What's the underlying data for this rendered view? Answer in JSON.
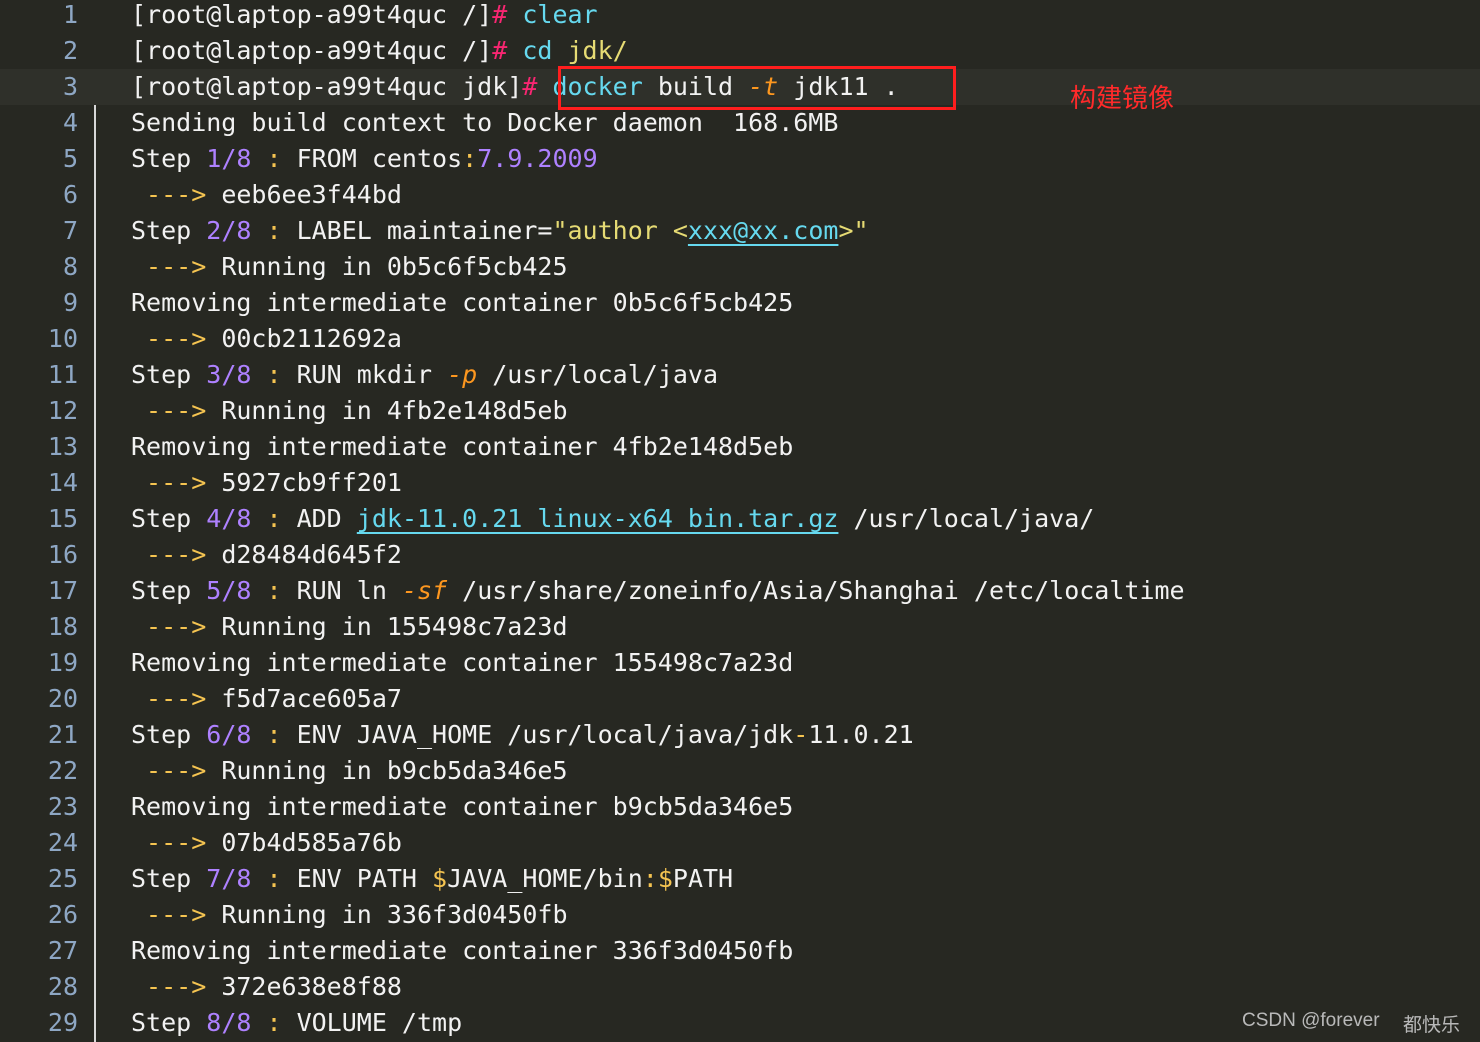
{
  "annotation": "构建镜像",
  "watermark": "CSDN @forever",
  "watermark_cn": "都快乐",
  "lines": [
    {
      "n": "1",
      "parts": [
        [
          "",
          "[root@laptop-a99t4quc /]"
        ],
        [
          "c-prompt",
          "# "
        ],
        [
          "c-cmd",
          "clear"
        ]
      ]
    },
    {
      "n": "2",
      "parts": [
        [
          "",
          "[root@laptop-a99t4quc /]"
        ],
        [
          "c-prompt",
          "# "
        ],
        [
          "c-cmd",
          "cd "
        ],
        [
          "c-str",
          "jdk/"
        ]
      ]
    },
    {
      "n": "3",
      "parts": [
        [
          "",
          "[root@laptop-a99t4quc jdk]"
        ],
        [
          "c-prompt",
          "# "
        ],
        [
          "c-cmd",
          "docker"
        ],
        [
          "",
          " build "
        ],
        [
          "c-flag",
          "-t"
        ],
        [
          "",
          " jdk11 ."
        ]
      ]
    },
    {
      "n": "4",
      "parts": [
        [
          "",
          "Sending build context to Docker daemon  168.6MB"
        ]
      ]
    },
    {
      "n": "5",
      "parts": [
        [
          "",
          "Step "
        ],
        [
          "c-num",
          "1/8"
        ],
        [
          "c-colon",
          " : "
        ],
        [
          "",
          "FROM centos"
        ],
        [
          "c-colon",
          ":"
        ],
        [
          "c-num",
          "7.9.2009"
        ]
      ]
    },
    {
      "n": "6",
      "parts": [
        [
          "c-colon",
          " ---> "
        ],
        [
          "",
          "eeb6ee3f44bd"
        ]
      ]
    },
    {
      "n": "7",
      "parts": [
        [
          "",
          "Step "
        ],
        [
          "c-num",
          "2/8"
        ],
        [
          "c-colon",
          " : "
        ],
        [
          "",
          "LABEL maintainer="
        ],
        [
          "c-str",
          "\"author <"
        ],
        [
          "c-link",
          "xxx@xx.com"
        ],
        [
          "c-str",
          ">\""
        ]
      ]
    },
    {
      "n": "8",
      "parts": [
        [
          "c-colon",
          " ---> "
        ],
        [
          "",
          "Running in 0b5c6f5cb425"
        ]
      ]
    },
    {
      "n": "9",
      "parts": [
        [
          "",
          "Removing intermediate container 0b5c6f5cb425"
        ]
      ]
    },
    {
      "n": "10",
      "parts": [
        [
          "c-colon",
          " ---> "
        ],
        [
          "",
          "00cb2112692a"
        ]
      ]
    },
    {
      "n": "11",
      "parts": [
        [
          "",
          "Step "
        ],
        [
          "c-num",
          "3/8"
        ],
        [
          "c-colon",
          " : "
        ],
        [
          "",
          "RUN mkdir "
        ],
        [
          "c-flag",
          "-p"
        ],
        [
          "",
          " /usr/local/java"
        ]
      ]
    },
    {
      "n": "12",
      "parts": [
        [
          "c-colon",
          " ---> "
        ],
        [
          "",
          "Running in 4fb2e148d5eb"
        ]
      ]
    },
    {
      "n": "13",
      "parts": [
        [
          "",
          "Removing intermediate container 4fb2e148d5eb"
        ]
      ]
    },
    {
      "n": "14",
      "parts": [
        [
          "c-colon",
          " ---> "
        ],
        [
          "",
          "5927cb9ff201"
        ]
      ]
    },
    {
      "n": "15",
      "parts": [
        [
          "",
          "Step "
        ],
        [
          "c-num",
          "4/8"
        ],
        [
          "c-colon",
          " : "
        ],
        [
          "",
          "ADD "
        ],
        [
          "c-link",
          "jdk-11.0.21_linux-x64_bin.tar.gz"
        ],
        [
          "",
          " /usr/local/java/"
        ]
      ]
    },
    {
      "n": "16",
      "parts": [
        [
          "c-colon",
          " ---> "
        ],
        [
          "",
          "d28484d645f2"
        ]
      ]
    },
    {
      "n": "17",
      "parts": [
        [
          "",
          "Step "
        ],
        [
          "c-num",
          "5/8"
        ],
        [
          "c-colon",
          " : "
        ],
        [
          "",
          "RUN ln "
        ],
        [
          "c-flag",
          "-sf"
        ],
        [
          "",
          " /usr/share/zoneinfo/Asia/Shanghai /etc/localtime"
        ]
      ]
    },
    {
      "n": "18",
      "parts": [
        [
          "c-colon",
          " ---> "
        ],
        [
          "",
          "Running in 155498c7a23d"
        ]
      ]
    },
    {
      "n": "19",
      "parts": [
        [
          "",
          "Removing intermediate container 155498c7a23d"
        ]
      ]
    },
    {
      "n": "20",
      "parts": [
        [
          "c-colon",
          " ---> "
        ],
        [
          "",
          "f5d7ace605a7"
        ]
      ]
    },
    {
      "n": "21",
      "parts": [
        [
          "",
          "Step "
        ],
        [
          "c-num",
          "6/8"
        ],
        [
          "c-colon",
          " : "
        ],
        [
          "",
          "ENV JAVA_HOME /usr/local/java/jdk"
        ],
        [
          "c-colon",
          "-"
        ],
        [
          "",
          "11.0.21"
        ]
      ]
    },
    {
      "n": "22",
      "parts": [
        [
          "c-colon",
          " ---> "
        ],
        [
          "",
          "Running in b9cb5da346e5"
        ]
      ]
    },
    {
      "n": "23",
      "parts": [
        [
          "",
          "Removing intermediate container b9cb5da346e5"
        ]
      ]
    },
    {
      "n": "24",
      "parts": [
        [
          "c-colon",
          " ---> "
        ],
        [
          "",
          "07b4d585a76b"
        ]
      ]
    },
    {
      "n": "25",
      "parts": [
        [
          "",
          "Step "
        ],
        [
          "c-num",
          "7/8"
        ],
        [
          "c-colon",
          " : "
        ],
        [
          "",
          "ENV PATH "
        ],
        [
          "c-colon",
          "$"
        ],
        [
          "",
          "JAVA_HOME/bin"
        ],
        [
          "c-colon",
          ":$"
        ],
        [
          "",
          "PATH"
        ]
      ]
    },
    {
      "n": "26",
      "parts": [
        [
          "c-colon",
          " ---> "
        ],
        [
          "",
          "Running in 336f3d0450fb"
        ]
      ]
    },
    {
      "n": "27",
      "parts": [
        [
          "",
          "Removing intermediate container 336f3d0450fb"
        ]
      ]
    },
    {
      "n": "28",
      "parts": [
        [
          "c-colon",
          " ---> "
        ],
        [
          "",
          "372e638e8f88"
        ]
      ]
    },
    {
      "n": "29",
      "parts": [
        [
          "",
          "Step "
        ],
        [
          "c-num",
          "8/8"
        ],
        [
          "c-colon",
          " : "
        ],
        [
          "",
          "VOLUME /tmp"
        ]
      ]
    }
  ]
}
